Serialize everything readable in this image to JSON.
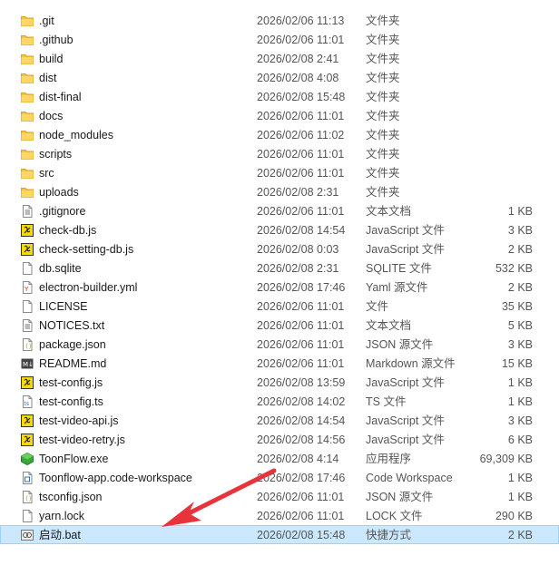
{
  "files": [
    {
      "name": ".git",
      "date": "2026/02/06 11:13",
      "type": "文件夹",
      "size": "",
      "icon": "folder-icon"
    },
    {
      "name": ".github",
      "date": "2026/02/06 11:01",
      "type": "文件夹",
      "size": "",
      "icon": "folder-icon"
    },
    {
      "name": "build",
      "date": "2026/02/08 2:41",
      "type": "文件夹",
      "size": "",
      "icon": "folder-icon"
    },
    {
      "name": "dist",
      "date": "2026/02/08 4:08",
      "type": "文件夹",
      "size": "",
      "icon": "folder-icon"
    },
    {
      "name": "dist-final",
      "date": "2026/02/08 15:48",
      "type": "文件夹",
      "size": "",
      "icon": "folder-icon"
    },
    {
      "name": "docs",
      "date": "2026/02/06 11:01",
      "type": "文件夹",
      "size": "",
      "icon": "folder-icon"
    },
    {
      "name": "node_modules",
      "date": "2026/02/06 11:02",
      "type": "文件夹",
      "size": "",
      "icon": "folder-icon"
    },
    {
      "name": "scripts",
      "date": "2026/02/06 11:01",
      "type": "文件夹",
      "size": "",
      "icon": "folder-icon"
    },
    {
      "name": "src",
      "date": "2026/02/06 11:01",
      "type": "文件夹",
      "size": "",
      "icon": "folder-icon"
    },
    {
      "name": "uploads",
      "date": "2026/02/08 2:31",
      "type": "文件夹",
      "size": "",
      "icon": "folder-icon"
    },
    {
      "name": ".gitignore",
      "date": "2026/02/06 11:01",
      "type": "文本文档",
      "size": "1 KB",
      "icon": "text-file-icon"
    },
    {
      "name": "check-db.js",
      "date": "2026/02/08 14:54",
      "type": "JavaScript 文件",
      "size": "3 KB",
      "icon": "js-file-icon"
    },
    {
      "name": "check-setting-db.js",
      "date": "2026/02/08 0:03",
      "type": "JavaScript 文件",
      "size": "2 KB",
      "icon": "js-file-icon"
    },
    {
      "name": "db.sqlite",
      "date": "2026/02/08 2:31",
      "type": "SQLITE 文件",
      "size": "532 KB",
      "icon": "blank-file-icon"
    },
    {
      "name": "electron-builder.yml",
      "date": "2026/02/08 17:46",
      "type": "Yaml 源文件",
      "size": "2 KB",
      "icon": "yaml-file-icon"
    },
    {
      "name": "LICENSE",
      "date": "2026/02/06 11:01",
      "type": "文件",
      "size": "35 KB",
      "icon": "blank-file-icon"
    },
    {
      "name": "NOTICES.txt",
      "date": "2026/02/06 11:01",
      "type": "文本文档",
      "size": "5 KB",
      "icon": "text-file-icon"
    },
    {
      "name": "package.json",
      "date": "2026/02/06 11:01",
      "type": "JSON 源文件",
      "size": "3 KB",
      "icon": "json-file-icon"
    },
    {
      "name": "README.md",
      "date": "2026/02/06 11:01",
      "type": "Markdown 源文件",
      "size": "15 KB",
      "icon": "markdown-file-icon"
    },
    {
      "name": "test-config.js",
      "date": "2026/02/08 13:59",
      "type": "JavaScript 文件",
      "size": "1 KB",
      "icon": "js-file-icon"
    },
    {
      "name": "test-config.ts",
      "date": "2026/02/08 14:02",
      "type": "TS 文件",
      "size": "1 KB",
      "icon": "ts-file-icon"
    },
    {
      "name": "test-video-api.js",
      "date": "2026/02/08 14:54",
      "type": "JavaScript 文件",
      "size": "3 KB",
      "icon": "js-file-icon"
    },
    {
      "name": "test-video-retry.js",
      "date": "2026/02/08 14:56",
      "type": "JavaScript 文件",
      "size": "6 KB",
      "icon": "js-file-icon"
    },
    {
      "name": "ToonFlow.exe",
      "date": "2026/02/08 4:14",
      "type": "应用程序",
      "size": "69,309 KB",
      "icon": "exe-app-icon"
    },
    {
      "name": "Toonflow-app.code-workspace",
      "date": "2026/02/08 17:46",
      "type": "Code Workspace",
      "size": "1 KB",
      "icon": "workspace-file-icon"
    },
    {
      "name": "tsconfig.json",
      "date": "2026/02/06 11:01",
      "type": "JSON 源文件",
      "size": "1 KB",
      "icon": "json-file-icon"
    },
    {
      "name": "yarn.lock",
      "date": "2026/02/06 11:01",
      "type": "LOCK 文件",
      "size": "290 KB",
      "icon": "blank-file-icon"
    },
    {
      "name": "启动.bat",
      "date": "2026/02/08 15:48",
      "type": "快捷方式",
      "size": "2 KB",
      "icon": "shortcut-icon",
      "selected": true
    }
  ],
  "colors": {
    "folder": "#f4c542",
    "selection_bg": "#cce8ff",
    "selection_border": "#99d1ff",
    "arrow": "#e8323c",
    "exe_green": "#3aa83a",
    "js_yellow": "#f5d90a"
  }
}
